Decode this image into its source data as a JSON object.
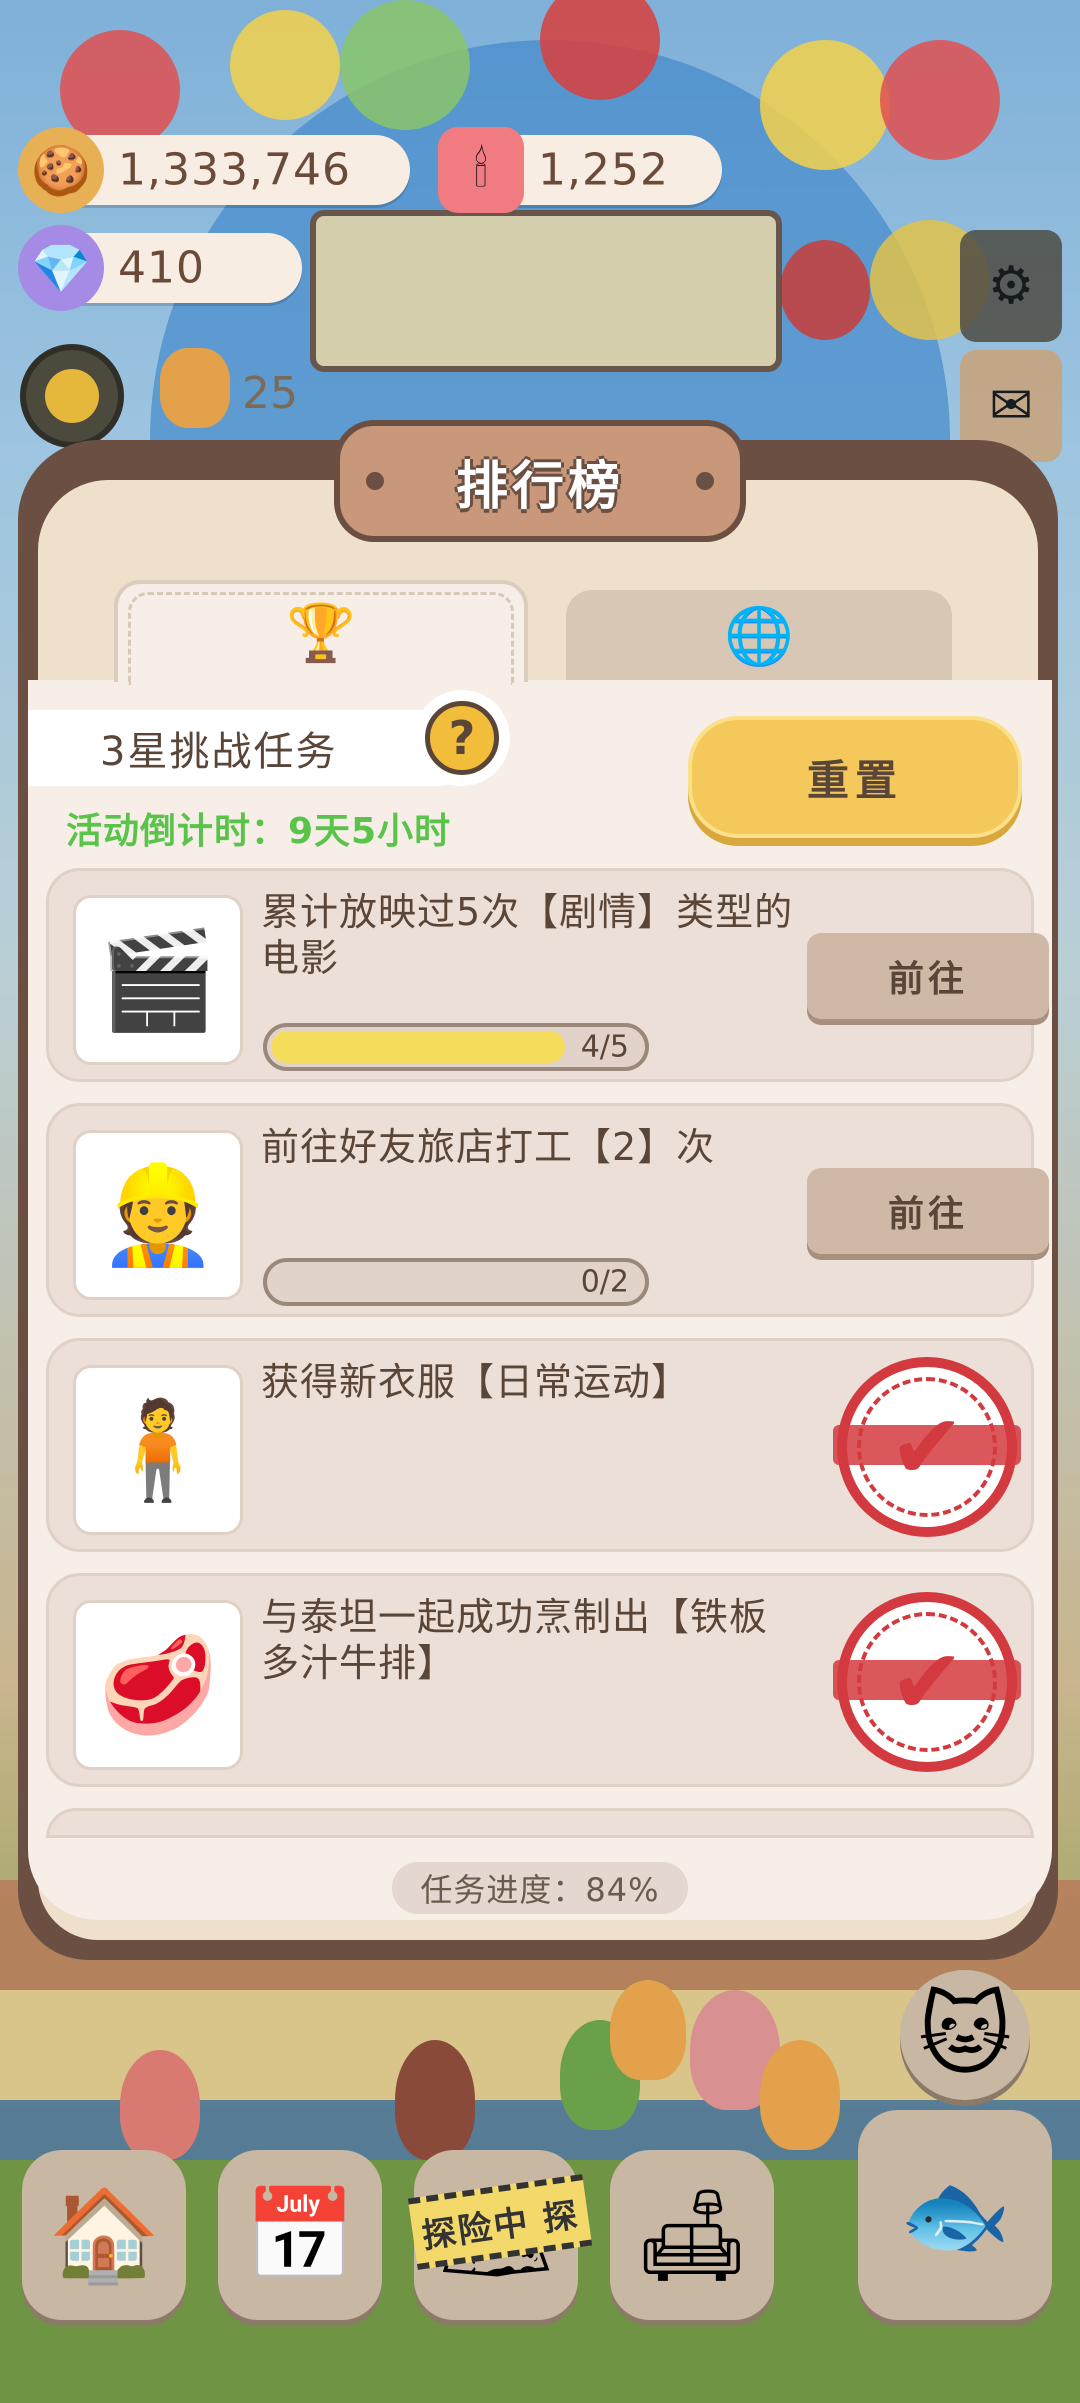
{
  "currencies": {
    "cookies": "1,333,746",
    "candles": "1,252",
    "crystals": "410"
  },
  "level": {
    "count": "25"
  },
  "panel": {
    "title": "排行榜",
    "tabs": [
      {
        "icon": "trophy-icon",
        "glyph": "🏆"
      },
      {
        "icon": "globe-icon",
        "glyph": "🌐"
      }
    ],
    "challenge_label": "3星挑战任务",
    "help_glyph": "?",
    "countdown": "活动倒计时：9天5小时",
    "reset_label": "重置",
    "progress_text": "任务进度：84%"
  },
  "tasks": [
    {
      "title": "累计放映过5次【剧情】类型的电影",
      "thumb_icon": "clapperboard-icon",
      "thumb_glyph": "🎬",
      "progress_text": "4/5",
      "progress": 0.8,
      "action": "前往",
      "done": false
    },
    {
      "title": "前往好友旅店打工【2】次",
      "thumb_icon": "worker-girl-icon",
      "thumb_glyph": "👷",
      "progress_text": "0/2",
      "progress": 0,
      "action": "前往",
      "done": false
    },
    {
      "title": "获得新衣服【日常运动】",
      "thumb_icon": "outfit-icon",
      "thumb_glyph": "🧍",
      "done": true
    },
    {
      "title": "与泰坦一起成功烹制出【铁板多汁牛排】",
      "thumb_icon": "steak-icon",
      "thumb_glyph": "🥩",
      "done": true
    }
  ],
  "bottom_nav": {
    "explore_label": "探险中 探",
    "items": [
      "mushroom-house-icon",
      "calendar-icon",
      "explore-icon",
      "room-icon",
      "fish-cat-icon"
    ]
  },
  "colors": {
    "panel_frame": "#6b4f42",
    "accent_yellow": "#f4c85a",
    "countdown_green": "#59c34a",
    "stamp_red": "#d33a3f"
  }
}
